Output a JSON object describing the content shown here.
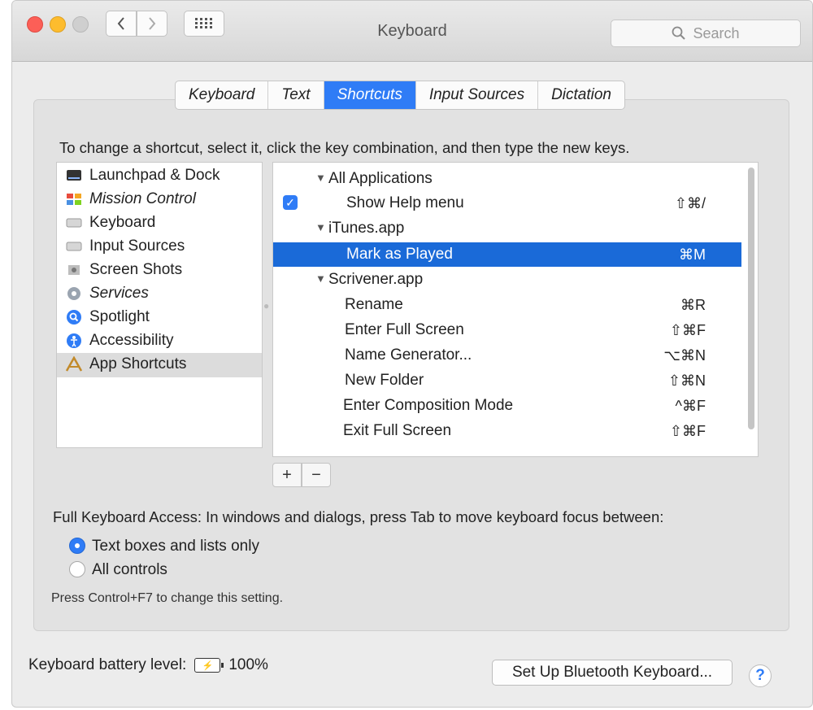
{
  "window": {
    "title": "Keyboard"
  },
  "search": {
    "placeholder": "Search"
  },
  "tabs": [
    {
      "label": "Keyboard"
    },
    {
      "label": "Text"
    },
    {
      "label": "Shortcuts",
      "active": true
    },
    {
      "label": "Input Sources"
    },
    {
      "label": "Dictation"
    }
  ],
  "instruction": "To change a shortcut, select it, click the key combination, and then type the new keys.",
  "categories": [
    {
      "label": "Launchpad & Dock",
      "icon": "launchpad-icon"
    },
    {
      "label": "Mission Control",
      "icon": "mission-control-icon"
    },
    {
      "label": "Keyboard",
      "icon": "keyboard-icon"
    },
    {
      "label": "Input Sources",
      "icon": "input-sources-icon"
    },
    {
      "label": "Screen Shots",
      "icon": "screenshot-icon"
    },
    {
      "label": "Services",
      "icon": "gear-icon"
    },
    {
      "label": "Spotlight",
      "icon": "spotlight-icon"
    },
    {
      "label": "Accessibility",
      "icon": "accessibility-icon"
    },
    {
      "label": "App Shortcuts",
      "icon": "app-shortcuts-icon",
      "selected": true
    }
  ],
  "shortcuts": {
    "group_all": "All Applications",
    "show_help": {
      "name": "Show Help menu",
      "key": "⇧⌘/"
    },
    "group_itunes": "iTunes.app",
    "mark_played": {
      "name": "Mark as Played",
      "key": "⌘M"
    },
    "group_scrivener": "Scrivener.app",
    "rename": {
      "name": "Rename",
      "key": "⌘R"
    },
    "enter_full": {
      "name": "Enter Full Screen",
      "key": "⇧⌘F"
    },
    "name_gen": {
      "name": "Name Generator...",
      "key": "⌥⌘N"
    },
    "new_folder": {
      "name": "New Folder",
      "key": "⇧⌘N"
    },
    "composition": {
      "name": "Enter Composition Mode",
      "key": "^⌘F"
    },
    "exit_full": {
      "name": "Exit Full Screen",
      "key": "⇧⌘F"
    }
  },
  "buttons": {
    "add": "+",
    "remove": "−"
  },
  "full_keyboard_access": {
    "label": "Full Keyboard Access: In windows and dialogs, press Tab to move keyboard focus between:",
    "option_text": "Text boxes and lists only",
    "option_all": "All controls",
    "selected": "Text boxes and lists only",
    "note": "Press Control+F7 to change this setting."
  },
  "battery": {
    "label": "Keyboard battery level:",
    "value": "100%"
  },
  "bluetooth_button": "Set Up Bluetooth Keyboard...",
  "help_label": "?",
  "colors": {
    "accent": "#2f7cf6",
    "selection": "#1a6ad8"
  }
}
